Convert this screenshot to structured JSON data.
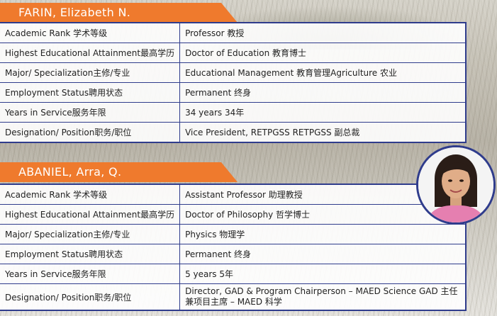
{
  "profiles": [
    {
      "name": "FARIN, Elizabeth N.",
      "rows": [
        {
          "label": "Academic Rank 学术等级",
          "value": "Professor    教授"
        },
        {
          "label": "Highest Educational Attainment最高学历",
          "value": "Doctor of Education 教育博士"
        },
        {
          "label": "Major/ Specialization主修/专业",
          "value": "Educational Management 教育管理Agriculture    农业"
        },
        {
          "label": "Employment Status聘用状态",
          "value": "Permanent    终身"
        },
        {
          "label": "Years in Service服务年限",
          "value": "34 years    34年"
        },
        {
          "label": "Designation/ Position职务/职位",
          "value": "Vice President, RETPGSS RETPGSS 副总裁"
        }
      ]
    },
    {
      "name": "ABANIEL, Arra, Q.",
      "rows": [
        {
          "label": "Academic Rank 学术等级",
          "value": "Assistant Professor    助理教授"
        },
        {
          "label": "Highest Educational Attainment最高学历",
          "value": "Doctor of Philosophy    哲学博士"
        },
        {
          "label": "Major/ Specialization主修/专业",
          "value": "Physics    物理学"
        },
        {
          "label": "Employment Status聘用状态",
          "value": "Permanent    终身"
        },
        {
          "label": "Years in Service服务年限",
          "value": "5 years    5年"
        },
        {
          "label": "Designation/ Position职务/职位",
          "value": "Director, GAD & Program Chairperson – MAED Science  GAD 主任兼项目主席 – MAED 科学"
        }
      ]
    }
  ],
  "colors": {
    "tab": "#ef7a2d",
    "border": "#2f3c8c"
  }
}
